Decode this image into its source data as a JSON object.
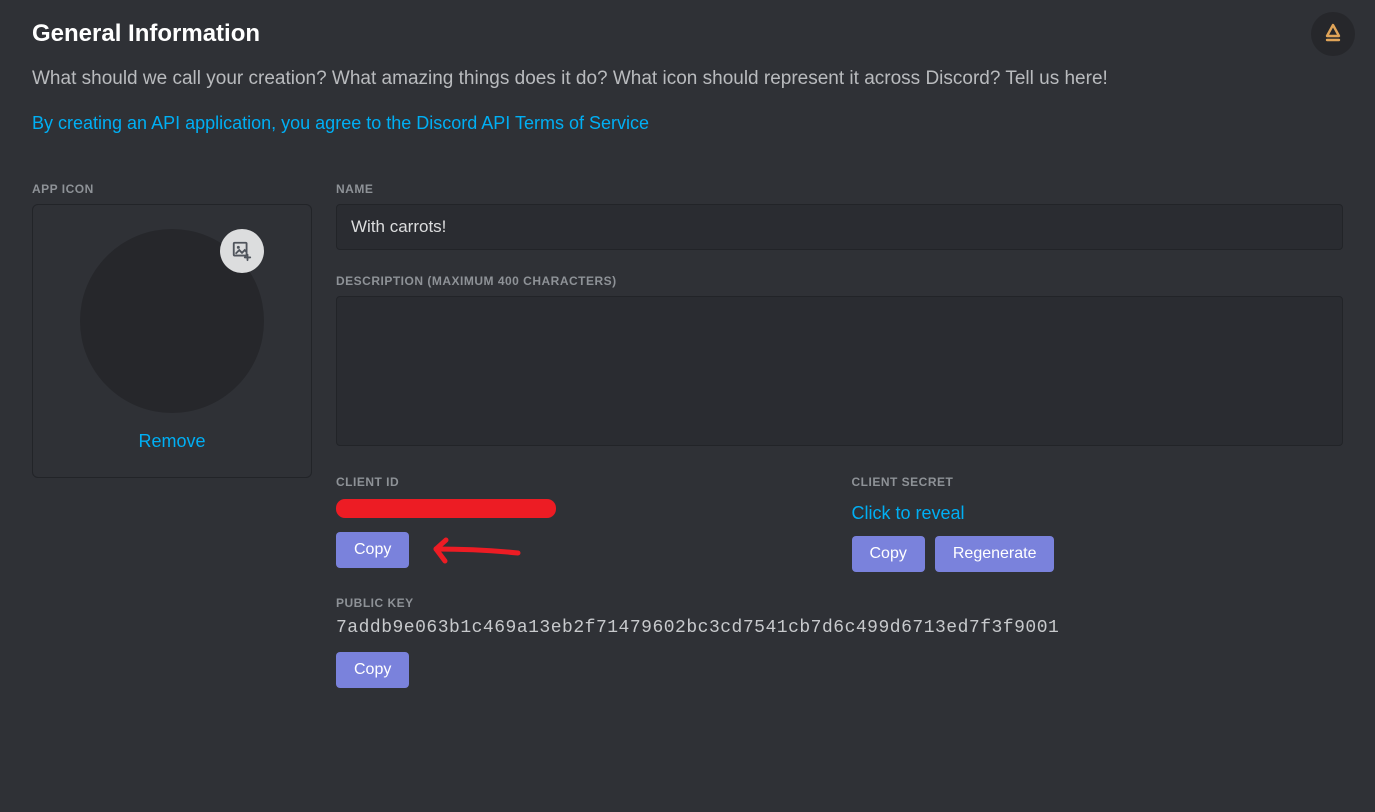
{
  "header": {
    "title": "General Information",
    "intro": "What should we call your creation? What amazing things does it do? What icon should represent it across Discord? Tell us here!",
    "agree_text": "By creating an API application, you agree to the Discord API Terms of Service"
  },
  "app_icon": {
    "label": "APP ICON",
    "remove_label": "Remove"
  },
  "name": {
    "label": "NAME",
    "value": "With carrots!"
  },
  "description": {
    "label": "DESCRIPTION (MAXIMUM 400 CHARACTERS)",
    "value": ""
  },
  "client_id": {
    "label": "CLIENT ID",
    "copy_label": "Copy"
  },
  "client_secret": {
    "label": "CLIENT SECRET",
    "reveal_label": "Click to reveal",
    "copy_label": "Copy",
    "regenerate_label": "Regenerate"
  },
  "public_key": {
    "label": "PUBLIC KEY",
    "value": "7addb9e063b1c469a13eb2f71479602bc3cd7541cb7d6c499d6713ed7f3f9001",
    "copy_label": "Copy"
  }
}
